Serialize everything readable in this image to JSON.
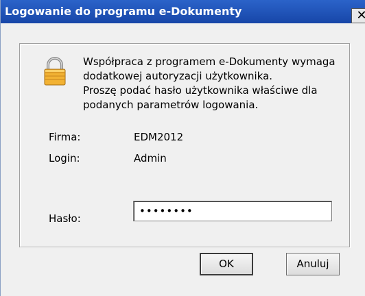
{
  "window": {
    "title": "Logowanie do programu e-Dokumenty",
    "close_glyph": "✕"
  },
  "message": {
    "line1": "Współpraca z programem e-Dokumenty wymaga",
    "line2": "dodatkowej autoryzacji użytkownika.",
    "line3": "Proszę podać hasło użytkownika właściwe dla",
    "line4": "podanych parametrów logowania."
  },
  "fields": {
    "firma_label": "Firma:",
    "firma_value": "EDM2012",
    "login_label": "Login:",
    "login_value": "Admin",
    "haslo_label": "Hasło:",
    "haslo_value": "••••••••"
  },
  "buttons": {
    "ok": "OK",
    "cancel": "Anuluj"
  },
  "icons": {
    "lock": "padlock-icon"
  },
  "colors": {
    "titlebar": "#1f56b8",
    "dialog_bg": "#f0f0f0",
    "lock_gold": "#f2b233"
  }
}
